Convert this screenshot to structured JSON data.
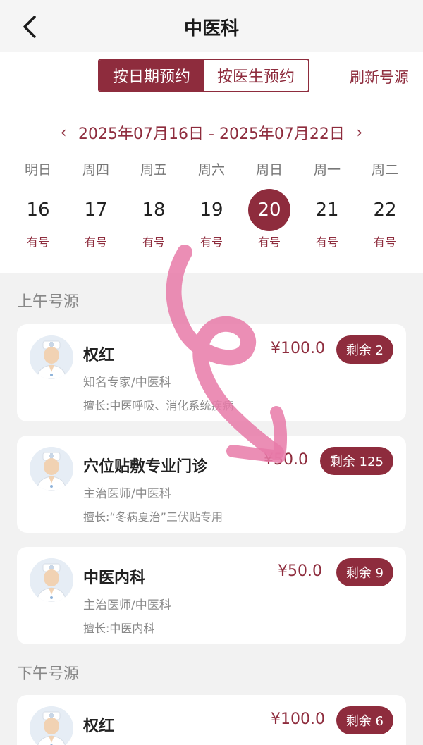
{
  "header": {
    "title": "中医科"
  },
  "tabs": [
    {
      "label": "按日期预约",
      "active": true
    },
    {
      "label": "按医生预约",
      "active": false
    }
  ],
  "refresh_label": "刷新号源",
  "date_range": {
    "label": "2025年07月16日 - 2025年07月22日",
    "prev": "‹",
    "next": "›"
  },
  "days": [
    {
      "week": "明日",
      "num": "16",
      "avail": "有号",
      "selected": false
    },
    {
      "week": "周四",
      "num": "17",
      "avail": "有号",
      "selected": false
    },
    {
      "week": "周五",
      "num": "18",
      "avail": "有号",
      "selected": false
    },
    {
      "week": "周六",
      "num": "19",
      "avail": "有号",
      "selected": false
    },
    {
      "week": "周日",
      "num": "20",
      "avail": "有号",
      "selected": true
    },
    {
      "week": "周一",
      "num": "21",
      "avail": "有号",
      "selected": false
    },
    {
      "week": "周二",
      "num": "22",
      "avail": "有号",
      "selected": false
    }
  ],
  "morning": {
    "title": "上午号源",
    "doctors": [
      {
        "name": "权红",
        "title": "知名专家/中医科",
        "skill": "擅长:中医呼吸、消化系统疾病",
        "price": "¥100.0",
        "remain": "剩余 2"
      },
      {
        "name": "穴位贴敷专业门诊",
        "title": "主治医师/中医科",
        "skill": "擅长:“冬病夏治”三伏贴专用",
        "price": "¥50.0",
        "remain": "剩余 125"
      },
      {
        "name": "中医内科",
        "title": "主治医师/中医科",
        "skill": "擅长:中医内科",
        "price": "¥50.0",
        "remain": "剩余 9"
      }
    ]
  },
  "afternoon": {
    "title": "下午号源",
    "doctors": [
      {
        "name": "权红",
        "price": "¥100.0",
        "remain": "剩余 6"
      }
    ]
  },
  "colors": {
    "accent": "#8e2c3d",
    "annotation_arrow": "#e87aa8"
  },
  "icons": {
    "back": "chevron-left-icon",
    "avatar": "doctor-avatar-icon"
  }
}
